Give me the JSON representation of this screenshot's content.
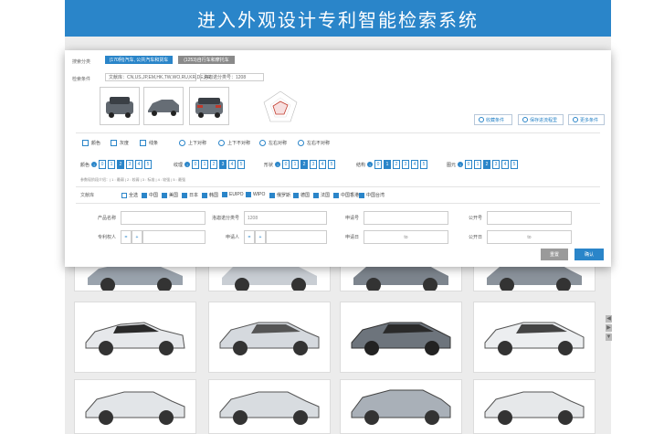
{
  "banner": {
    "title": "进入外观设计专利智能检索系统"
  },
  "panel": {
    "scope": {
      "label": "搜索分类",
      "chips": [
        {
          "text": "(170例)汽车, 公共汽车和货车",
          "active": true
        },
        {
          "text": "(1253)自行车和摩托车",
          "active": false
        }
      ]
    },
    "conditions": {
      "label": "检索条件",
      "library": "文献库：CN,US,JP,EM,HK,TW,WO,RU,KR,DE,FR",
      "locarno": "洛迦诺分类号：1208"
    },
    "actions": {
      "favorite": "收藏条件",
      "save": "保存进流程里",
      "more": "更多条件"
    },
    "view_options": [
      {
        "label": "颜色",
        "kind": "checkbox"
      },
      {
        "label": "灰度",
        "kind": "checkbox"
      },
      {
        "label": "线条",
        "kind": "checkbox"
      },
      {
        "label": "上下对称",
        "kind": "radio"
      },
      {
        "label": "上下不对称",
        "kind": "radio"
      },
      {
        "label": "左右对称",
        "kind": "radio"
      },
      {
        "label": "左右不对称",
        "kind": "radio"
      }
    ],
    "scales": [
      {
        "label": "颜色",
        "values": [
          "0",
          "1",
          "2",
          "3",
          "4",
          "5"
        ],
        "selected": [
          2
        ]
      },
      {
        "label": "纹理",
        "values": [
          "0",
          "1",
          "2",
          "3",
          "4",
          "5"
        ],
        "selected": [
          3
        ]
      },
      {
        "label": "形状",
        "values": [
          "0",
          "1",
          "2",
          "3",
          "4",
          "5"
        ],
        "selected": [
          2
        ]
      },
      {
        "label": "结构",
        "values": [
          "0",
          "1",
          "2",
          "3",
          "4",
          "5"
        ],
        "selected": [
          1
        ]
      },
      {
        "label": "图元",
        "values": [
          "0",
          "1",
          "2",
          "3",
          "4",
          "5"
        ],
        "selected": [
          2
        ]
      }
    ],
    "scale_legend": "参数现阶段介绍：| 1 : 最弱 | 2 : 较弱 | 3 : 标准 | 4 : 较强 | 5 : 最强",
    "libraries": {
      "label": "文献库",
      "items": [
        {
          "text": "全选",
          "checked": false
        },
        {
          "text": "中国",
          "checked": true
        },
        {
          "text": "美国",
          "checked": true
        },
        {
          "text": "日本",
          "checked": true
        },
        {
          "text": "韩国",
          "checked": true
        },
        {
          "text": "EUIPO",
          "checked": true
        },
        {
          "text": "WIPO",
          "checked": true
        },
        {
          "text": "俄罗斯",
          "checked": true
        },
        {
          "text": "德国",
          "checked": true
        },
        {
          "text": "法国",
          "checked": true
        },
        {
          "text": "中国香港",
          "checked": true
        },
        {
          "text": "中国台湾",
          "checked": true
        }
      ]
    },
    "fields": {
      "product_name": "产品名称",
      "locarno_no": "洛迦诺分类号",
      "locarno_value": "1208",
      "app_no": "申请号",
      "pub_no": "公开号",
      "patentee": "专利权人",
      "applicant": "申请人",
      "app_date": "申请日",
      "pub_date": "公开日",
      "to": "to",
      "eq": "=",
      "plus": "+"
    },
    "buttons": {
      "reset": "重置",
      "confirm": "确认"
    }
  },
  "results": {
    "count_shown": 12,
    "car_color": "#d9dde2"
  }
}
